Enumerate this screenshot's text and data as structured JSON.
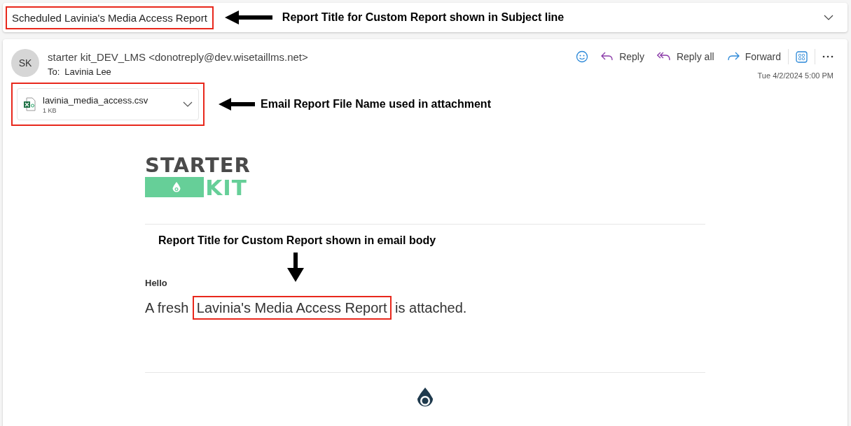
{
  "subject_bar": {
    "subject": "Scheduled Lavinia's Media Access Report",
    "subject_highlighted": true,
    "callout": "Report Title for Custom Report shown in Subject line"
  },
  "message": {
    "avatar_initials": "SK",
    "sender": "starter kit_DEV_LMS <donotreply@dev.wisetaillms.net>",
    "to_label": "To:",
    "recipient": "Lavinia Lee",
    "actions": [
      {
        "kind": "emoji"
      },
      {
        "kind": "reply",
        "label": "Reply"
      },
      {
        "kind": "reply_all",
        "label": "Reply all"
      },
      {
        "kind": "forward",
        "label": "Forward"
      },
      {
        "kind": "apps"
      },
      {
        "kind": "more"
      }
    ],
    "date": "Tue 4/2/2024 5:00 PM",
    "attachment": {
      "file_name": "lavinia_media_access.csv",
      "size": "1 KB",
      "highlighted": true,
      "callout": "Email Report File Name used in attachment"
    }
  },
  "email_body": {
    "logo_top": "STARTER",
    "logo_bottom": "KIT",
    "callout": "Report Title for Custom Report shown in email body",
    "greeting": "Hello",
    "text_before": "A fresh",
    "report_title": "Lavinia's Media Access Report",
    "title_highlighted": true,
    "text_after": "is attached."
  }
}
